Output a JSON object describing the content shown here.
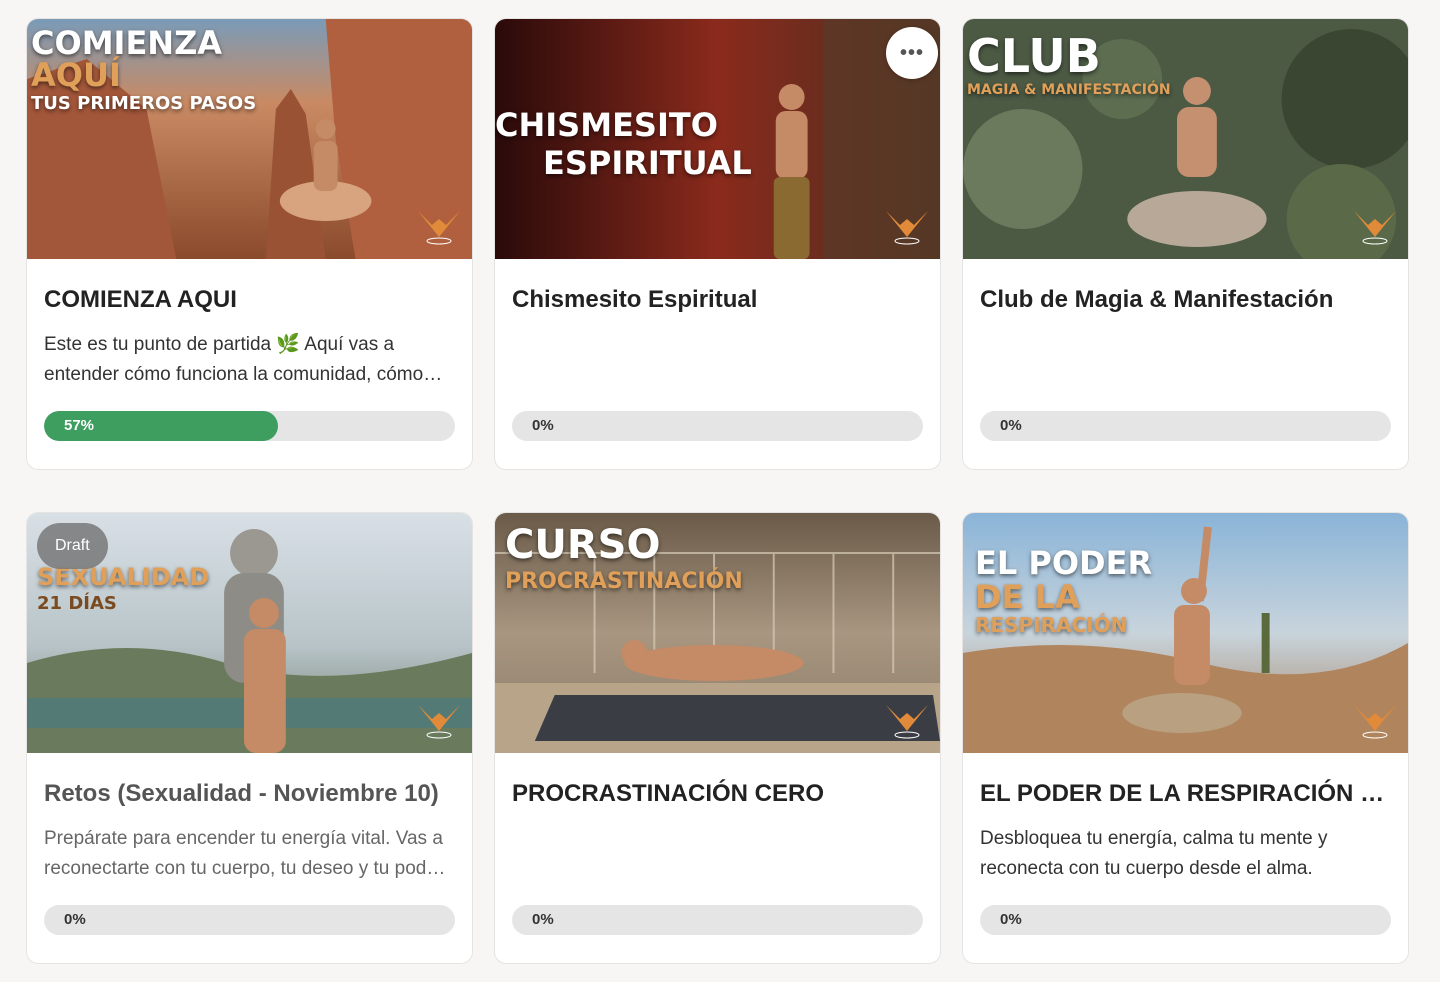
{
  "courses": [
    {
      "thumb": {
        "line1": "COMIENZA",
        "line2": "AQUÍ",
        "line3": "TUS PRIMEROS PASOS"
      },
      "title": "COMIENZA AQUI",
      "description": "Este es tu punto de partida 🌿 Aquí vas a entender cómo funciona la comunidad, cómo aprovechar el contenido y cómo empezar.",
      "progress_label": "57%",
      "progress": 0.57
    },
    {
      "thumb": {
        "line1": "CHISMESITO",
        "line2": "ESPIRITUAL"
      },
      "title": "Chismesito Espiritual",
      "description": "",
      "progress_label": "0%",
      "progress": 0,
      "more_icon": "•••"
    },
    {
      "thumb": {
        "line1": "CLUB",
        "line2": "MAGIA & MANIFESTACIÓN"
      },
      "title": "Club de Magia & Manifestación",
      "description": "",
      "progress_label": "0%",
      "progress": 0
    },
    {
      "thumb": {
        "line1": "SEXUALIDAD",
        "line2": "21 DÍAS"
      },
      "draft_label": "Draft",
      "title": "Retos (Sexualidad - Noviembre 10)",
      "description": "Prepárate para encender tu energía vital. Vas a reconectarte con tu cuerpo, tu deseo y tu poder interior.",
      "progress_label": "0%",
      "progress": 0
    },
    {
      "thumb": {
        "line1": "CURSO",
        "line2": "PROCRASTINACIÓN"
      },
      "title": "PROCRASTINACIÓN CERO",
      "description": "",
      "progress_label": "0%",
      "progress": 0
    },
    {
      "thumb": {
        "line1": "EL PODER",
        "line2": "DE LA",
        "line3": "RESPIRACIÓN"
      },
      "title": "EL PODER DE LA RESPIRACIÓN CONSCIENTE",
      "description": "Desbloquea tu energía, calma tu mente y reconecta con tu cuerpo desde el alma.",
      "progress_label": "0%",
      "progress": 0
    }
  ]
}
